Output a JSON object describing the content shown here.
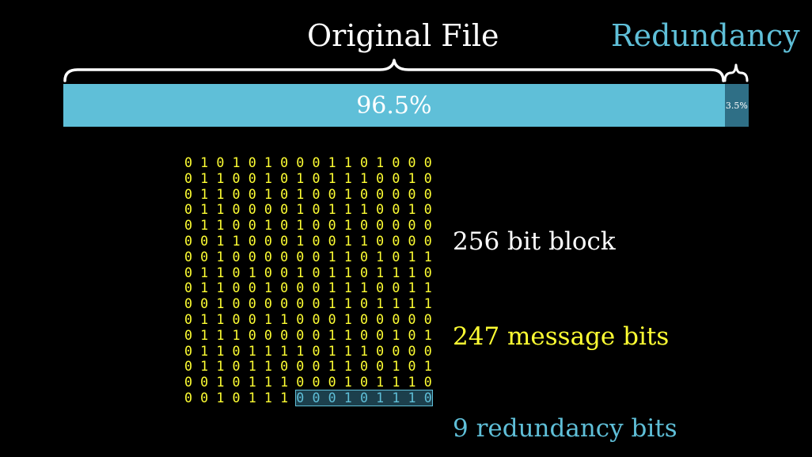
{
  "header": {
    "original_label": "Original File",
    "redundancy_label": "Redundancy"
  },
  "bar": {
    "main_percent": 96.5,
    "main_label": "96.5%",
    "redundancy_percent": 3.5,
    "redundancy_label": "3.5%"
  },
  "bits": {
    "rows": [
      "0101010001101000",
      "0110010101110010",
      "0110010100100000",
      "0110000101110010",
      "0110010100100000",
      "0011000100110000",
      "0010000001101011",
      "0110100101101110",
      "0110010001110011",
      "0010000001101111",
      "0110011000100000",
      "0111000001100101",
      "0110111101110000",
      "0110110001100101",
      "0010111000101110",
      "0010111000101110"
    ],
    "message_bits_in_last_row": 7
  },
  "labels": {
    "block": "256 bit block",
    "message": "247 message bits",
    "redundancy": "9 redundancy bits"
  },
  "colors": {
    "background": "#000000",
    "main_bar": "#5fbfd8",
    "redundancy_bar": "#2f6f86",
    "message_bits": "#ffff33",
    "redundancy_text": "#5fbfd8",
    "white_text": "#ffffff"
  }
}
